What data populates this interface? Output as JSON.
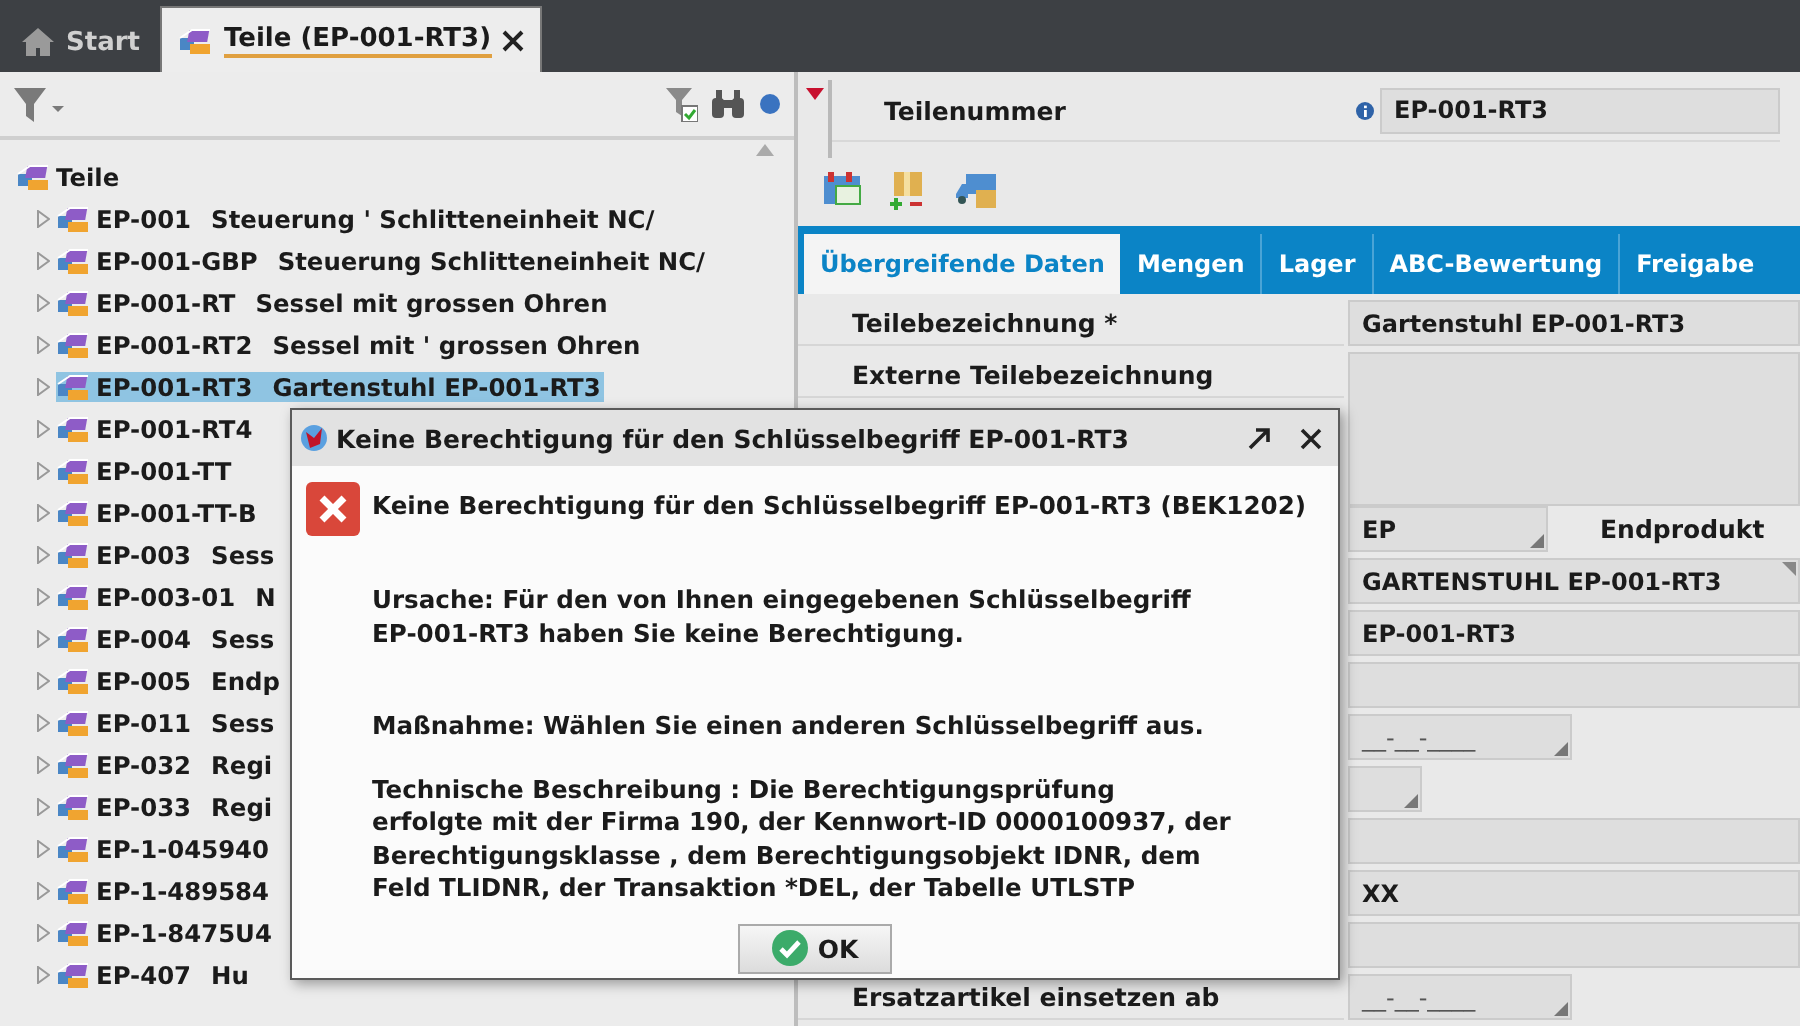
{
  "tabs": [
    {
      "label": "Start",
      "selected": false,
      "closable": false
    },
    {
      "label": "Teile (EP-001-RT3)",
      "selected": true,
      "closable": true
    }
  ],
  "tree": {
    "label": "Teile",
    "children": [
      {
        "code": "EP-001",
        "desc": "Steuerung ' Schlitteneinheit NC/",
        "expanded": false,
        "selected": false
      },
      {
        "code": "EP-001-GBP",
        "desc": "Steuerung Schlitteneinheit NC/",
        "expanded": false,
        "selected": false
      },
      {
        "code": "EP-001-RT",
        "desc": "Sessel mit grossen Ohren",
        "expanded": false,
        "selected": false
      },
      {
        "code": "EP-001-RT2",
        "desc": "Sessel mit ' grossen Ohren",
        "expanded": false,
        "selected": false
      },
      {
        "code": "EP-001-RT3",
        "desc": "Gartenstuhl EP-001-RT3",
        "expanded": false,
        "selected": true
      },
      {
        "code": "EP-001-RT4",
        "expanded": false,
        "selected": false
      },
      {
        "code": "EP-001-TT",
        "expanded": false,
        "selected": false
      },
      {
        "code": "EP-001-TT-B",
        "expanded": false,
        "selected": false
      },
      {
        "code": "EP-003",
        "desc": "Sess",
        "expanded": false,
        "selected": false
      },
      {
        "code": "EP-003-01",
        "desc": "N",
        "expanded": false,
        "selected": false
      },
      {
        "code": "EP-004",
        "desc": "Sess",
        "expanded": false,
        "selected": false
      },
      {
        "code": "EP-005",
        "desc": "Endp",
        "expanded": false,
        "selected": false
      },
      {
        "code": "EP-011",
        "desc": "Sess",
        "expanded": false,
        "selected": false
      },
      {
        "code": "EP-032",
        "desc": "Regi",
        "expanded": false,
        "selected": false
      },
      {
        "code": "EP-033",
        "desc": "Regi",
        "expanded": false,
        "selected": false
      },
      {
        "code": "EP-1-045940",
        "expanded": false,
        "selected": false
      },
      {
        "code": "EP-1-489584",
        "expanded": false,
        "selected": false
      },
      {
        "code": "EP-1-8475U4",
        "expanded": false,
        "selected": false
      },
      {
        "code": "EP-407",
        "desc": "Hu",
        "expanded": false,
        "selected": false
      }
    ]
  },
  "header": {
    "label": "Teilenummer",
    "value": "EP-001-RT3"
  },
  "detail_tabs": [
    {
      "label": "Übergreifende Daten",
      "selected": true
    },
    {
      "label": "Mengen",
      "selected": false
    },
    {
      "label": "Lager",
      "selected": false
    },
    {
      "label": "ABC-Bewertung",
      "selected": false
    },
    {
      "label": "Freigabe",
      "selected": false
    }
  ],
  "form": [
    {
      "kind": "text",
      "label": "Teilebezeichnung *",
      "value": "Gartenstuhl EP-001-RT3"
    },
    {
      "kind": "area",
      "label": "Externe Teilebezeichnung"
    },
    {
      "kind": "select",
      "value": "EP",
      "note": "Endprodukt"
    },
    {
      "kind": "lookup",
      "value": "GARTENSTUHL EP-001-RT3"
    },
    {
      "kind": "text",
      "value": "EP-001-RT3"
    },
    {
      "kind": "empty"
    },
    {
      "kind": "date",
      "placeholder": "__-__-____"
    },
    {
      "kind": "small_select"
    },
    {
      "kind": "empty"
    },
    {
      "kind": "text",
      "value": "XX"
    },
    {
      "kind": "empty"
    },
    {
      "kind": "date",
      "label": "Ersatzartikel einsetzen ab",
      "placeholder": "__-__-____"
    }
  ],
  "dialog": {
    "title": "Keine Berechtigung für den Schlüsselbegriff EP-001-RT3",
    "heading": "Keine Berechtigung für den Schlüsselbegriff EP-001-RT3 (BEK1202)",
    "paragraphs": [
      "Ursache: Für den von Ihnen eingegebenen Schlüsselbegriff\nEP-001-RT3 haben Sie keine Berechtigung.",
      "Maßnahme: Wählen Sie einen anderen Schlüsselbegriff aus.",
      "Technische Beschreibung : Die Berechtigungsprüfung\nerfolgte mit der Firma 190, der Kennwort-ID 0000100937, der\nBerechtigungsklasse , dem Berechtigungsobjekt IDNR, dem\nFeld TLIDNR, der Transaktion *DEL, der Tabelle UTLSTP"
    ],
    "button": "OK"
  }
}
